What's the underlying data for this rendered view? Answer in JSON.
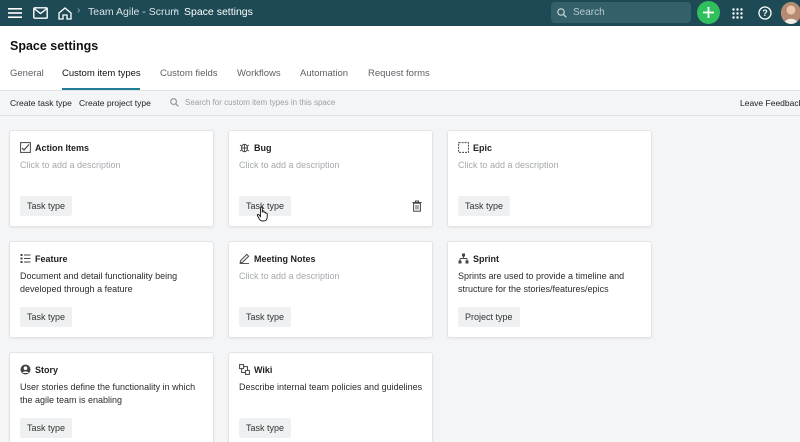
{
  "topbar": {
    "breadcrumbs": [
      "Team Agile - Scrum",
      "Space settings"
    ],
    "search_placeholder": "Search",
    "icons": [
      "hamburger-menu-icon",
      "inbox-icon",
      "home-icon",
      "plus-icon",
      "app-grid-icon",
      "help-icon"
    ],
    "colors": {
      "bar": "#1e4a55",
      "create": "#2fbf5d"
    }
  },
  "page": {
    "title": "Space settings",
    "tabs": [
      "General",
      "Custom item types",
      "Custom fields",
      "Workflows",
      "Automation",
      "Request forms"
    ],
    "active_tab": "Custom item types"
  },
  "toolbar": {
    "create_task_type": "Create task type",
    "create_project_type": "Create project type",
    "search_placeholder": "Search for custom item types in this space",
    "leave_feedback": "Leave Feedback"
  },
  "cards": [
    {
      "title": "Action Items",
      "description": "Click to add a description",
      "placeholder": true,
      "type": "Task type",
      "icon": "checklist-icon"
    },
    {
      "title": "Bug",
      "description": "Click to add a description",
      "placeholder": true,
      "type": "Task type",
      "icon": "bug-icon"
    },
    {
      "title": "Epic",
      "description": "Click to add a description",
      "placeholder": true,
      "type": "Task type",
      "icon": "epic-square-icon"
    },
    {
      "title": "Feature",
      "description": "Document and detail functionality being developed through a feature",
      "placeholder": false,
      "type": "Task type",
      "icon": "list-icon"
    },
    {
      "title": "Meeting Notes",
      "description": "Click to add a description",
      "placeholder": true,
      "type": "Task type",
      "icon": "pencil-icon"
    },
    {
      "title": "Sprint",
      "description": "Sprints are used to provide a timeline and structure for the stories/features/epics",
      "placeholder": false,
      "type": "Project type",
      "icon": "sprint-tree-icon"
    },
    {
      "title": "Story",
      "description": "User stories define the functionality in which the agile team is enabling",
      "placeholder": false,
      "type": "Task type",
      "icon": "story-person-icon"
    },
    {
      "title": "Wiki",
      "description": "Describe internal team policies and guidelines",
      "placeholder": false,
      "type": "Task type",
      "icon": "wiki-icon"
    }
  ]
}
